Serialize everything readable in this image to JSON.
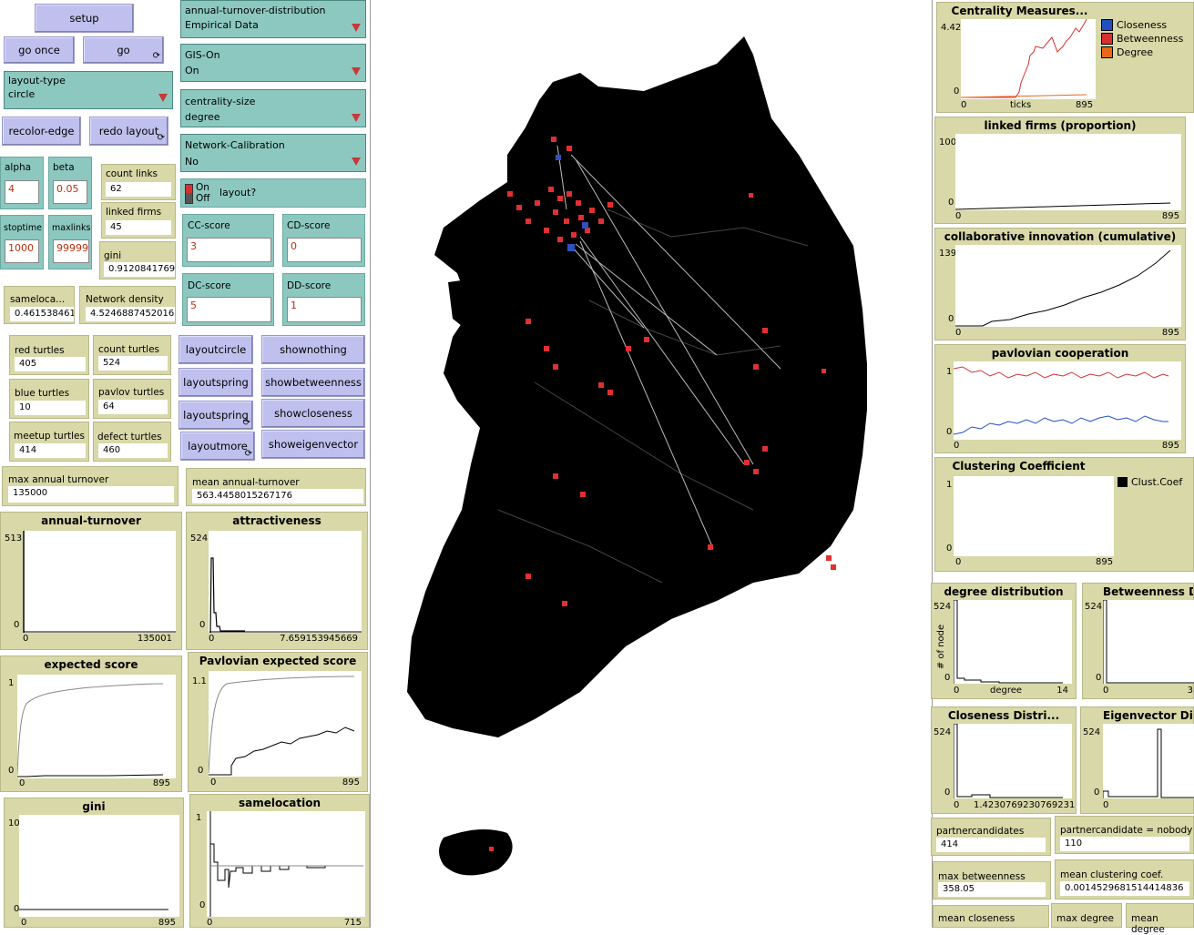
{
  "buttons": {
    "setup": "setup",
    "go_once": "go once",
    "go": "go",
    "recolor_edge": "recolor-edge",
    "redo_layout": "redo layout",
    "layoutcircle": "layoutcircle",
    "layoutspring": "layoutspring",
    "layoutspring2": "layoutspring",
    "layoutmore": "layoutmore",
    "shownothing": "shownothing",
    "showbetweenness": "showbetweenness",
    "showcloseness": "showcloseness",
    "showeigenvector": "showeigenvector",
    "forever_glyph": "⟳"
  },
  "choosers": {
    "layout_type": {
      "label": "layout-type",
      "value": "circle"
    },
    "turnover_dist": {
      "label": "annual-turnover-distribution",
      "value": "Empirical Data"
    },
    "gis_on": {
      "label": "GIS-On",
      "value": "On"
    },
    "centrality_size": {
      "label": "centrality-size",
      "value": "degree"
    },
    "network_calibration": {
      "label": "Network-Calibration",
      "value": "No"
    }
  },
  "switch": {
    "on": "On",
    "off": "Off",
    "label": "layout?"
  },
  "inputs": {
    "alpha": {
      "label": "alpha",
      "value": "4"
    },
    "beta": {
      "label": "beta",
      "value": "0.05"
    },
    "stoptime": {
      "label": "stoptime",
      "value": "1000"
    },
    "maxlinks": {
      "label": "maxlinks",
      "value": "99999"
    },
    "cc_score": {
      "label": "CC-score",
      "value": "3"
    },
    "cd_score": {
      "label": "CD-score",
      "value": "0"
    },
    "dc_score": {
      "label": "DC-score",
      "value": "5"
    },
    "dd_score": {
      "label": "DD-score",
      "value": "1"
    }
  },
  "monitors": {
    "count_links": {
      "label": "count links",
      "value": "62"
    },
    "linked_firms": {
      "label": "linked firms",
      "value": "45"
    },
    "gini": {
      "label": "gini",
      "value": "0.9120841769"
    },
    "sameloca": {
      "label": "sameloca...",
      "value": "0.461538461"
    },
    "network_density": {
      "label": "Network density",
      "value": "4.5246887452016"
    },
    "red_turtles": {
      "label": "red turtles",
      "value": "405"
    },
    "count_turtles": {
      "label": "count turtles",
      "value": "524"
    },
    "blue_turtles": {
      "label": "blue turtles",
      "value": "10"
    },
    "pavlov_turtles": {
      "label": "pavlov turtles",
      "value": "64"
    },
    "meetup_turtles": {
      "label": "meetup turtles",
      "value": "414"
    },
    "defect_turtles": {
      "label": "defect turtles",
      "value": "460"
    },
    "max_annual_turnover": {
      "label": "max annual turnover",
      "value": "135000"
    },
    "mean_annual_turnover": {
      "label": "mean annual-turnover",
      "value": "563.4458015267176"
    },
    "partnercandidates": {
      "label": "partnercandidates",
      "value": "414"
    },
    "partnercandidate_nobody": {
      "label": "partnercandidate = nobody",
      "value": "110"
    },
    "max_betweenness": {
      "label": "max betweenness",
      "value": "358.05"
    },
    "mean_clustering": {
      "label": "mean clustering coef.",
      "value": "0.0014529681514414836"
    },
    "mean_closeness": {
      "label": "mean closeness"
    },
    "max_degree": {
      "label": "max degree"
    },
    "mean_degree": {
      "label": "mean degree"
    }
  },
  "plots": {
    "annual_turnover": {
      "title": "annual-turnover",
      "ymax": "513",
      "ymin": "0",
      "xmin": "0",
      "xmax": "135001"
    },
    "attractiveness": {
      "title": "attractiveness",
      "ymax": "524",
      "ymin": "0",
      "xmin": "0",
      "xmax": "7.659153945669"
    },
    "expected_score": {
      "title": "expected score",
      "ymax": "1",
      "ymin": "0",
      "xmin": "0",
      "xmax": "895"
    },
    "pavlovian_expected": {
      "title": "Pavlovian expected score",
      "ymax": "1.1",
      "ymin": "0",
      "xmin": "0",
      "xmax": "895"
    },
    "gini": {
      "title": "gini",
      "ymax": "10",
      "ymin": "0",
      "xmin": "0",
      "xmax": "895"
    },
    "samelocation": {
      "title": "samelocation",
      "ymax": "1",
      "ymin": "0",
      "xmin": "0",
      "xmax": "715"
    },
    "centrality": {
      "title": "Centrality Measures...",
      "ymax": "4.42",
      "ymin": "0",
      "xmin": "0",
      "xmax": "895",
      "xlabel": "ticks",
      "legend": [
        {
          "name": "Closeness",
          "color": "#2050c0"
        },
        {
          "name": "Betweenness",
          "color": "#d83030"
        },
        {
          "name": "Degree",
          "color": "#e86818"
        }
      ]
    },
    "linked_firms": {
      "title": "linked firms (proportion)",
      "ymax": "100",
      "ymin": "0",
      "xmin": "0",
      "xmax": "895"
    },
    "collab_innovation": {
      "title": "collaborative innovation (cumulative)",
      "ymax": "139",
      "ymin": "0",
      "xmin": "0",
      "xmax": "895"
    },
    "pavlovian_coop": {
      "title": "pavlovian cooperation",
      "ymax": "1",
      "ymin": "0",
      "xmin": "0",
      "xmax": "895"
    },
    "clustering": {
      "title": "Clustering Coefficient",
      "ymax": "1",
      "ymin": "0",
      "xmin": "0",
      "xmax": "895",
      "legend": [
        {
          "name": "Clust.Coef",
          "color": "#000000"
        }
      ]
    },
    "degree_dist": {
      "title": "degree distribution",
      "ymax": "524",
      "ymin": "0",
      "xmin": "0",
      "xmax": "14",
      "xlabel": "degree",
      "ylabel": "# of node"
    },
    "betweenness_dist": {
      "title": "Betweenness Di",
      "ymax": "524",
      "ymin": "0",
      "xmin": "0",
      "xmax": "3"
    },
    "closeness_dist": {
      "title": "Closeness Distri...",
      "ymax": "524",
      "ymin": "0",
      "xmin": "0",
      "xmax": "1.4230769230769231"
    },
    "eigenvector_dist": {
      "title": "Eigenvector Dis",
      "ymax": "524",
      "ymin": "0",
      "xmin": "0"
    }
  }
}
